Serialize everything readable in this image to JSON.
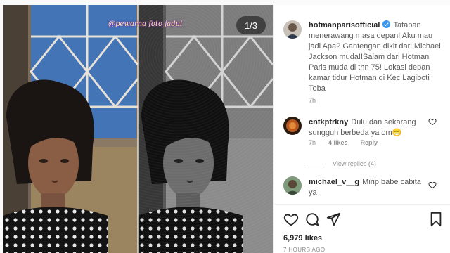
{
  "media": {
    "counter": "1/3",
    "watermark": "@pewarna foto jadul"
  },
  "caption": {
    "username": "hotmanparisofficial",
    "text": "Tatapan menerawang masa depan! Aku mau jadi Apa? Gantengan dikit dari Michael Jackson muda!!Salam dari Hotman Paris muda di thn 75! Lokasi depan kamar tidur Hotman di Kec Lagiboti Toba",
    "time": "7h"
  },
  "comments": [
    {
      "username": "cntkptrkny",
      "text": "Dulu dan sekarang sungguh berbeda ya om😁",
      "time": "7h",
      "likes": "4 likes",
      "reply": "Reply",
      "view_replies": "View replies (4)"
    },
    {
      "username": "michael_v__g",
      "text": "Mirip babe cabita ya"
    }
  ],
  "footer": {
    "likes": "6,979 likes",
    "posted": "7 HOURS AGO"
  },
  "icons": {
    "like": "heart-icon",
    "comment": "comment-icon",
    "share": "share-icon",
    "save": "bookmark-icon"
  },
  "colors": {
    "verified": "#3897f0",
    "muted": "#8e8e8e",
    "text": "#262626"
  }
}
